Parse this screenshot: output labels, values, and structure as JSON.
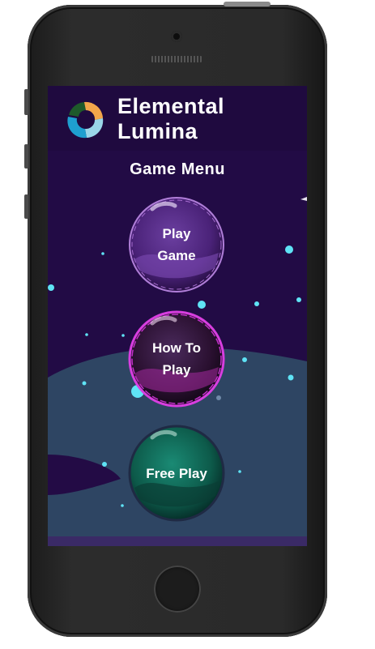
{
  "app": {
    "title": "Elemental\nLumina"
  },
  "menu": {
    "title": "Game Menu",
    "buttons": [
      {
        "label": "Play\nGame",
        "color": "#6a2f98"
      },
      {
        "label": "How To\nPlay",
        "color": "#7a1f6a"
      },
      {
        "label": "Free Play",
        "color": "#0f6a5a"
      }
    ]
  },
  "colors": {
    "background": "#220b45",
    "header": "#1f0a3f",
    "planet": "#2e4563",
    "particle": "#5fe3f5",
    "logo": [
      "#1e5a2a",
      "#f2a64a",
      "#9ad6e8",
      "#1e9fcf"
    ]
  }
}
